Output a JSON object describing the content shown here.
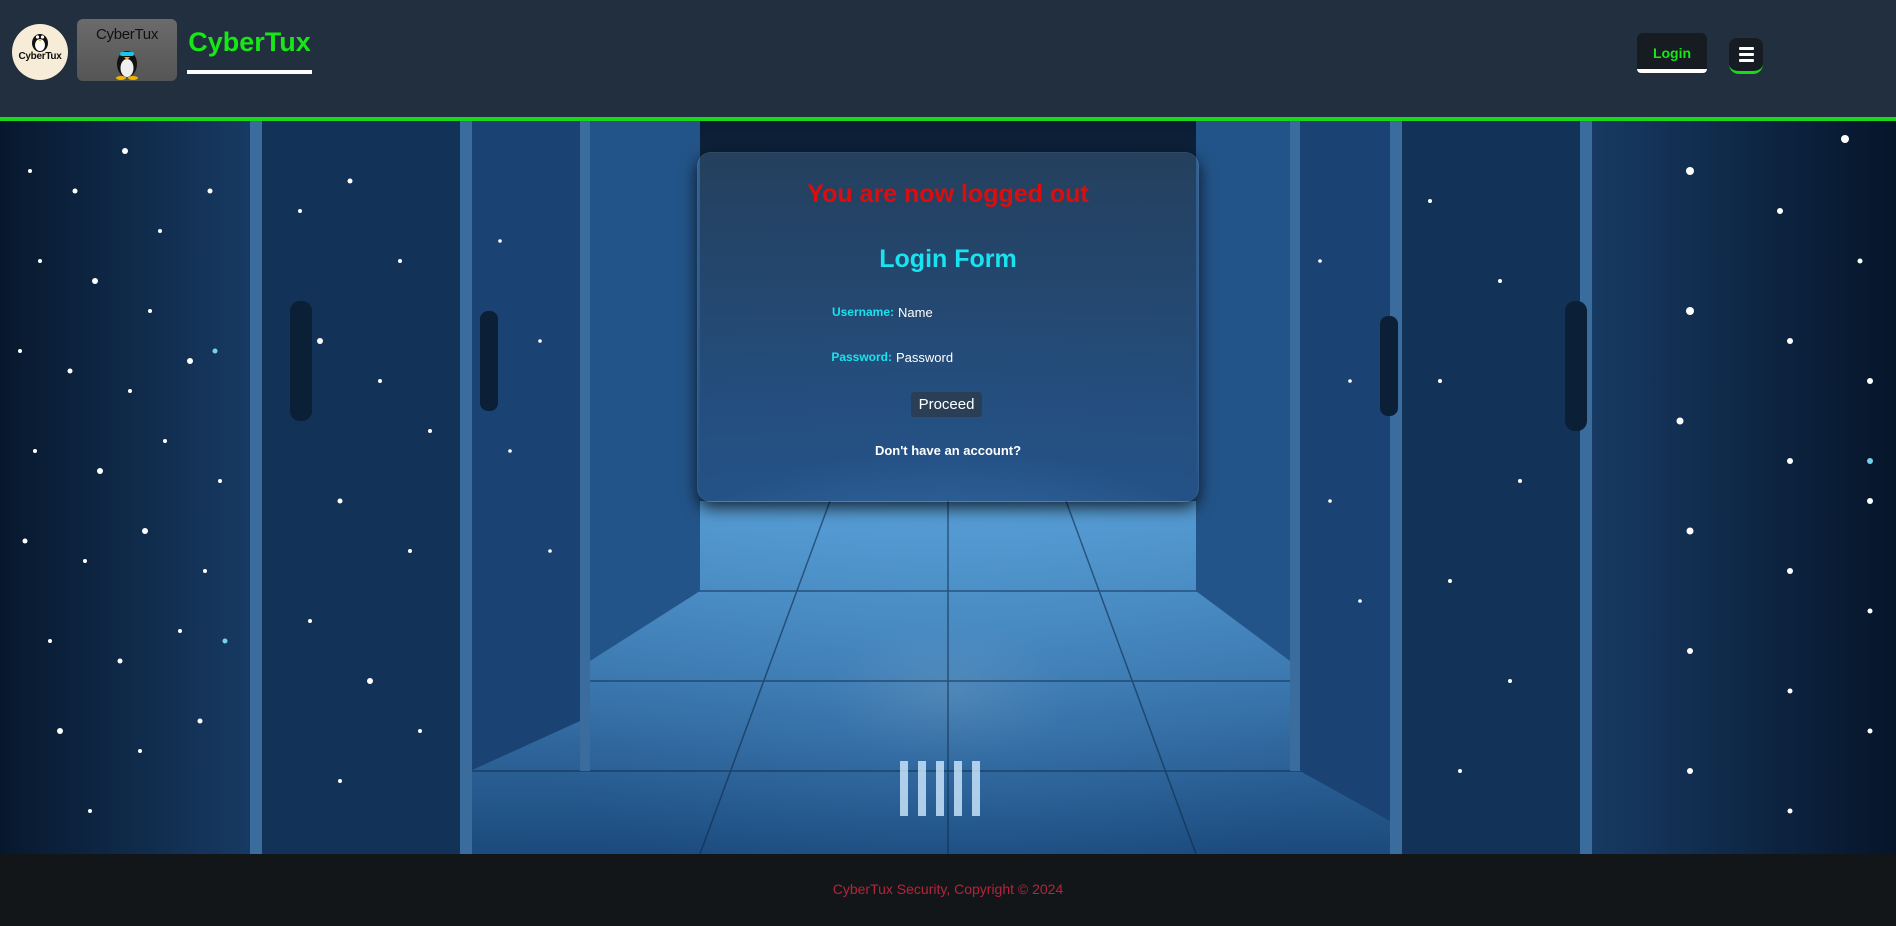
{
  "header": {
    "round_logo_text": "CyberTux",
    "square_logo_text": "CyberTux",
    "brand": "CyberTux",
    "login_label": "Login",
    "menu_icon": "hamburger-icon"
  },
  "login_card": {
    "logout_message": "You are now logged out",
    "form_title": "Login Form",
    "username_label": "Username:",
    "username_placeholder": "Name",
    "password_label": "Password:",
    "password_placeholder": "Password",
    "proceed_label": "Proceed",
    "signup_link": "Don't have an account?"
  },
  "footer": {
    "copyright": "CyberTux Security, Copyright © 2024"
  },
  "colors": {
    "header_bg": "#222f3e",
    "accent_green": "#1ad81a",
    "logout_red": "#dd0d0d",
    "form_cyan": "#19e3f0",
    "footer_text": "#b5243a"
  }
}
